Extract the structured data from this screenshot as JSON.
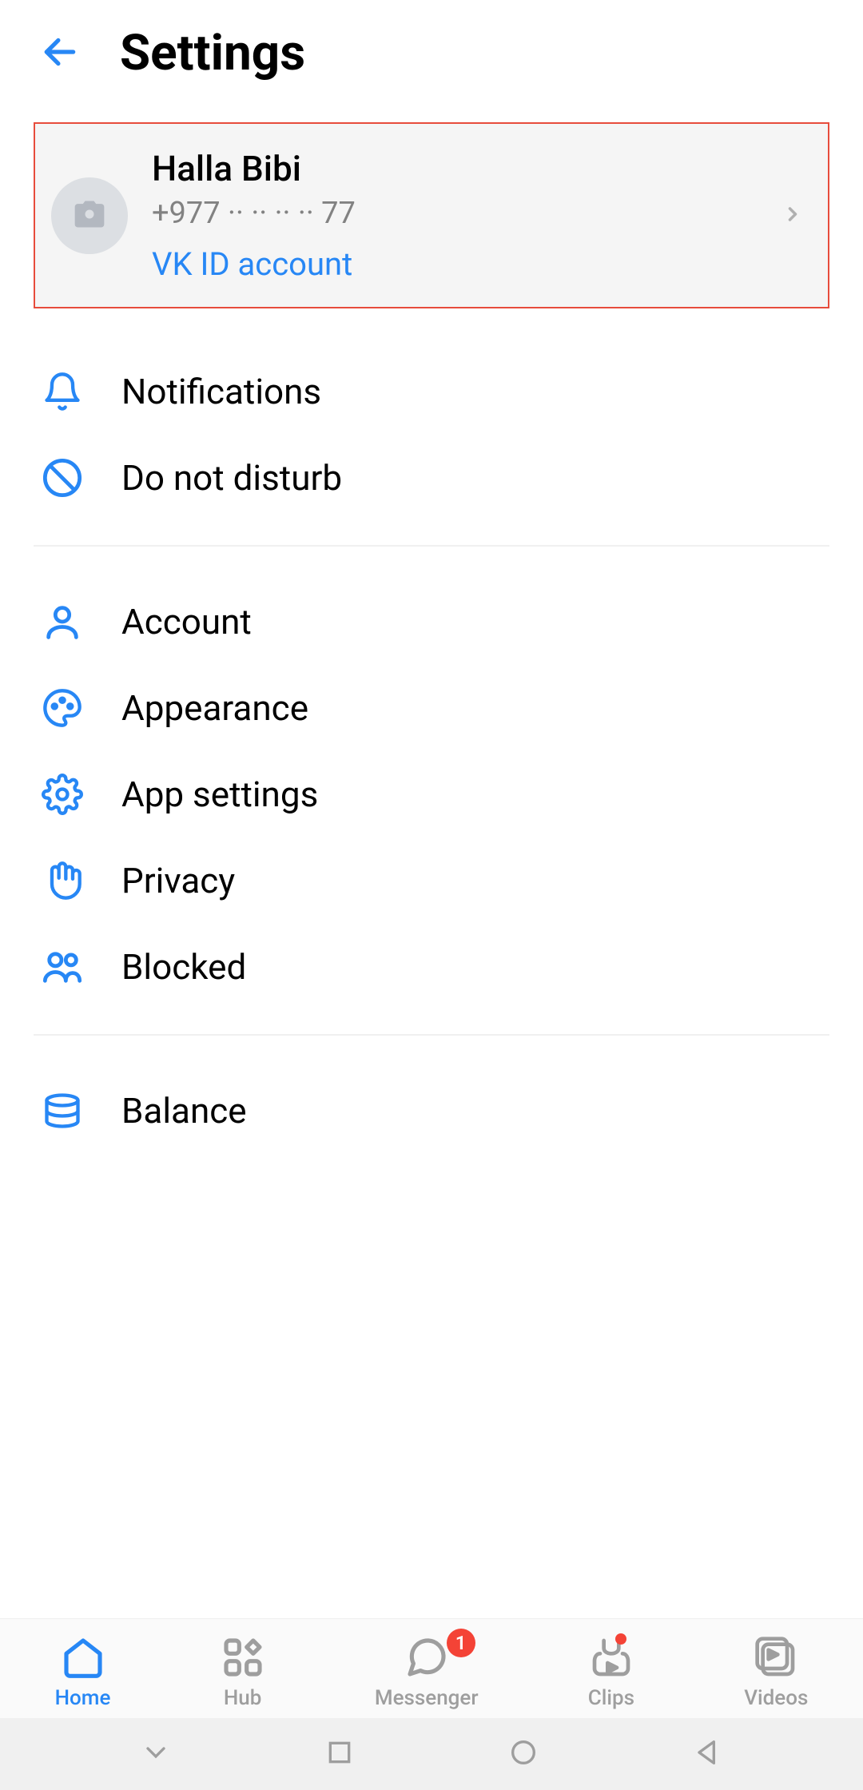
{
  "header": {
    "title": "Settings"
  },
  "profile": {
    "name": "Halla Bibi",
    "phone": "+977  ·· ·· ·· ·· 77",
    "vk_label": "VK ID account"
  },
  "sections": {
    "group1": [
      {
        "icon": "bell",
        "label": "Notifications"
      },
      {
        "icon": "prohibit",
        "label": "Do not disturb"
      }
    ],
    "group2": [
      {
        "icon": "person",
        "label": "Account"
      },
      {
        "icon": "palette",
        "label": "Appearance"
      },
      {
        "icon": "gear",
        "label": "App settings"
      },
      {
        "icon": "hand",
        "label": "Privacy"
      },
      {
        "icon": "people",
        "label": "Blocked"
      }
    ],
    "group3": [
      {
        "icon": "coins",
        "label": "Balance"
      }
    ]
  },
  "bottom_nav": {
    "items": [
      {
        "icon": "home",
        "label": "Home",
        "active": true
      },
      {
        "icon": "hub",
        "label": "Hub"
      },
      {
        "icon": "chat",
        "label": "Messenger",
        "badge": "1"
      },
      {
        "icon": "clips",
        "label": "Clips",
        "dot": true
      },
      {
        "icon": "videos",
        "label": "Videos"
      }
    ]
  },
  "colors": {
    "primary": "#2787f5",
    "highlight_border": "#e74c3c",
    "inactive": "#9e9e9e"
  }
}
